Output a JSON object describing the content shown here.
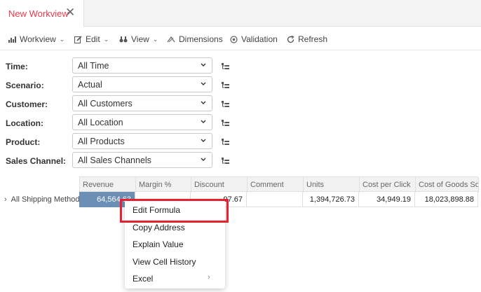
{
  "tab": {
    "title": "New Workview",
    "close_glyph": "✕"
  },
  "toolbar": {
    "items": [
      {
        "label": "Workview",
        "icon": "chart-icon",
        "caret": true
      },
      {
        "label": "Edit",
        "icon": "edit-icon",
        "caret": true
      },
      {
        "label": "View",
        "icon": "binoculars-icon",
        "caret": true
      },
      {
        "label": "Dimensions",
        "icon": "dimensions-icon",
        "caret": false
      },
      {
        "label": "Validation",
        "icon": "validation-icon",
        "caret": false
      },
      {
        "label": "Refresh",
        "icon": "refresh-icon",
        "caret": false
      }
    ]
  },
  "filters": [
    {
      "label": "Time:",
      "value": "All Time"
    },
    {
      "label": "Scenario:",
      "value": "Actual"
    },
    {
      "label": "Customer:",
      "value": "All Customers"
    },
    {
      "label": "Location:",
      "value": "All Location"
    },
    {
      "label": "Product:",
      "value": "All Products"
    },
    {
      "label": "Sales Channel:",
      "value": "All Sales Channels"
    }
  ],
  "grid": {
    "columns": [
      "Revenue",
      "Margin %",
      "Discount",
      "Comment",
      "Units",
      "Cost per Click",
      "Cost of Goods Sold"
    ],
    "row_header": "All Shipping Methods",
    "row_values": [
      "64,564,63",
      "",
      "97.67",
      "",
      "1,394,726.73",
      "34,949.19",
      "18,023,898.88"
    ]
  },
  "context_menu": {
    "items": [
      "Edit Formula",
      "Copy Address",
      "Explain Value",
      "View Cell History",
      "Excel"
    ],
    "submenu_glyph": "›"
  },
  "colors": {
    "accent": "#e8394a",
    "selected_cell": "#6b8fb5",
    "highlight": "#e8202f"
  }
}
